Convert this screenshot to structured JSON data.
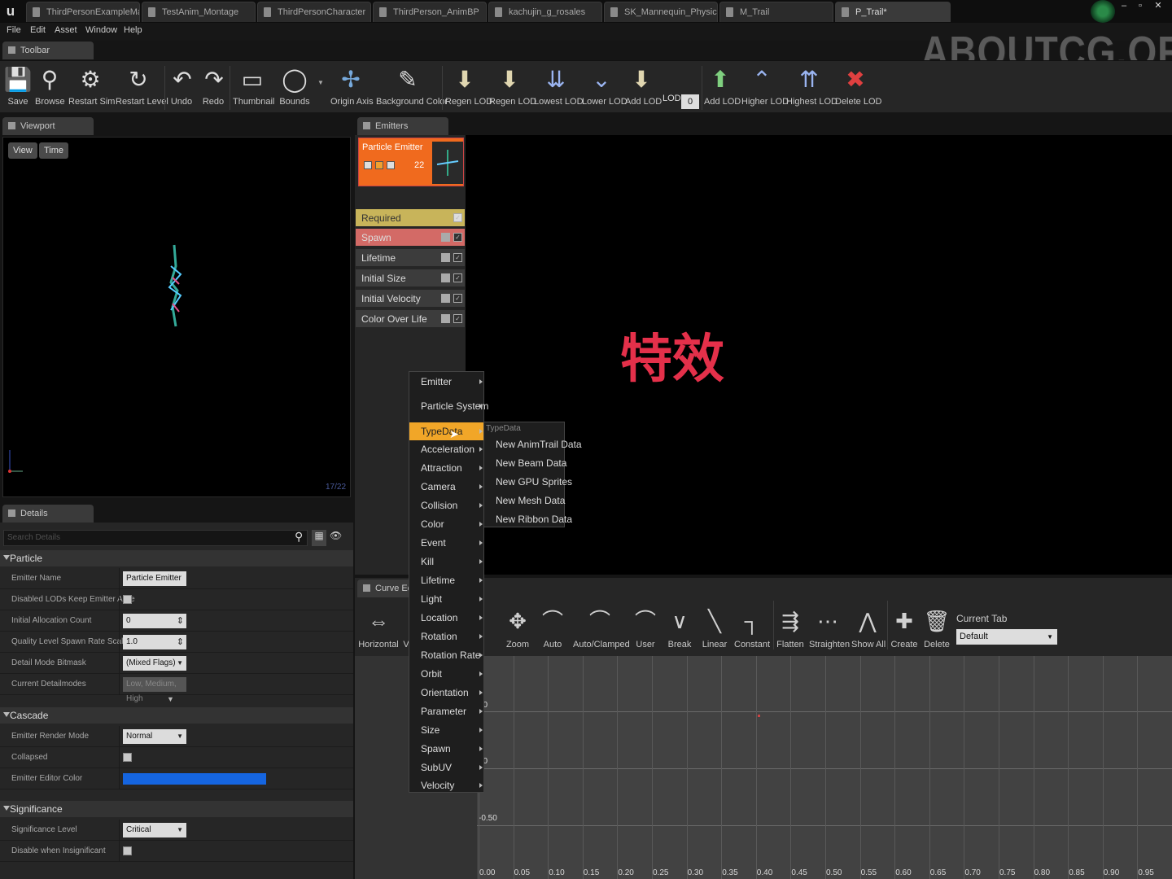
{
  "doc_tabs": [
    {
      "label": "ThirdPersonExampleMap"
    },
    {
      "label": "TestAnim_Montage"
    },
    {
      "label": "ThirdPersonCharacter"
    },
    {
      "label": "ThirdPerson_AnimBP"
    },
    {
      "label": "kachujin_g_rosales"
    },
    {
      "label": "SK_Mannequin_PhysicsAs"
    },
    {
      "label": "M_Trail"
    },
    {
      "label": "P_Trail*"
    }
  ],
  "logo": "u",
  "window_controls": [
    "–",
    "▫",
    "✕"
  ],
  "menu": [
    "File",
    "Edit",
    "Asset",
    "Window",
    "Help"
  ],
  "watermark": "ABOUTCG.ORG",
  "toolbar_tab": "Toolbar",
  "toolbar": [
    {
      "label": "Save",
      "icon": "save-icon"
    },
    {
      "label": "Browse",
      "icon": "browse-icon"
    },
    {
      "label": "Restart Sim",
      "icon": "restart-sim-icon"
    },
    {
      "label": "Restart Level",
      "icon": "restart-level-icon"
    },
    {
      "label": "Undo",
      "icon": "undo-icon"
    },
    {
      "label": "Redo",
      "icon": "redo-icon"
    },
    {
      "label": "Thumbnail",
      "icon": "thumbnail-icon"
    },
    {
      "label": "Bounds",
      "icon": "bounds-icon"
    },
    {
      "label": "Origin Axis",
      "icon": "origin-axis-icon"
    },
    {
      "label": "Background Color",
      "icon": "background-color-icon"
    },
    {
      "label": "Regen LOD",
      "icon": "regen-lod-icon"
    },
    {
      "label": "Regen LOD",
      "icon": "regen-lod-icon"
    },
    {
      "label": "Lowest LOD",
      "icon": "lowest-lod-icon"
    },
    {
      "label": "Lower LOD",
      "icon": "lower-lod-icon"
    },
    {
      "label": "Add LOD",
      "icon": "add-lod-icon"
    },
    {
      "label": "Add LOD",
      "icon": "add-lod-icon"
    },
    {
      "label": "Higher LOD",
      "icon": "higher-lod-icon"
    },
    {
      "label": "Highest LOD",
      "icon": "highest-lod-icon"
    },
    {
      "label": "Delete LOD",
      "icon": "delete-lod-icon"
    }
  ],
  "lod": {
    "label": "LOD",
    "value": "0"
  },
  "viewport": {
    "tab": "Viewport",
    "view_btn": "View",
    "time_btn": "Time",
    "counter": "17/22"
  },
  "details": {
    "tab": "Details",
    "search_placeholder": "Search Details",
    "categories": {
      "particle": "Particle",
      "cascade": "Cascade",
      "significance": "Significance"
    },
    "particle_props": [
      {
        "label": "Emitter Name",
        "value": "Particle Emitter"
      },
      {
        "label": "Disabled LODs Keep Emitter Alive",
        "value": ""
      },
      {
        "label": "Initial Allocation Count",
        "value": "0"
      },
      {
        "label": "Quality Level Spawn Rate Scale",
        "value": "1.0"
      },
      {
        "label": "Detail Mode Bitmask",
        "value": "(Mixed Flags)"
      },
      {
        "label": "Current Detailmodes",
        "value": "Low, Medium, High"
      }
    ],
    "cascade_props": [
      {
        "label": "Emitter Render Mode",
        "value": "Normal"
      },
      {
        "label": "Collapsed",
        "value": ""
      },
      {
        "label": "Emitter Editor Color",
        "value": "#1565e0"
      }
    ],
    "significance_props": [
      {
        "label": "Significance Level",
        "value": "Critical"
      },
      {
        "label": "Disable when Insignificant",
        "value": ""
      }
    ]
  },
  "emitters": {
    "tab": "Emitters",
    "emitter_name": "Particle Emitter",
    "emitter_count": "22",
    "modules": [
      "Required",
      "Spawn",
      "Lifetime",
      "Initial Size",
      "Initial Velocity",
      "Color Over Life"
    ]
  },
  "overlay_text": "特效",
  "context_menu": {
    "items": [
      "Emitter",
      "Particle System",
      "TypeData",
      "Acceleration",
      "Attraction",
      "Camera",
      "Collision",
      "Color",
      "Event",
      "Kill",
      "Lifetime",
      "Light",
      "Location",
      "Rotation",
      "Rotation Rate",
      "Orbit",
      "Orientation",
      "Parameter",
      "Size",
      "Spawn",
      "SubUV",
      "Velocity"
    ],
    "highlighted": "TypeData"
  },
  "submenu": {
    "header": "TypeData",
    "items": [
      "New AnimTrail Data",
      "New Beam Data",
      "New GPU Sprites",
      "New Mesh Data",
      "New Ribbon Data"
    ]
  },
  "curve_editor": {
    "tab": "Curve Editor",
    "buttons": [
      {
        "label": "Horizontal",
        "icon": "horizontal-fit-icon"
      },
      {
        "label": "V",
        "icon": "vertical-fit-icon"
      },
      {
        "label": "Zoom",
        "icon": "zoom-icon"
      },
      {
        "label": "Auto",
        "icon": "auto-tangent-icon"
      },
      {
        "label": "Auto/Clamped",
        "icon": "auto-clamped-icon"
      },
      {
        "label": "User",
        "icon": "user-tangent-icon"
      },
      {
        "label": "Break",
        "icon": "break-tangent-icon"
      },
      {
        "label": "Linear",
        "icon": "linear-icon"
      },
      {
        "label": "Constant",
        "icon": "constant-icon"
      },
      {
        "label": "Flatten",
        "icon": "flatten-icon"
      },
      {
        "label": "Straighten",
        "icon": "straighten-icon"
      },
      {
        "label": "Show All",
        "icon": "show-all-icon"
      },
      {
        "label": "Create",
        "icon": "create-icon"
      },
      {
        "label": "Delete",
        "icon": "delete-icon"
      }
    ],
    "current_tab_label": "Current Tab",
    "current_tab_value": "Default",
    "y_labels": [
      "50",
      "00",
      "-0.50"
    ],
    "x_labels": [
      "0.00",
      "0.05",
      "0.10",
      "0.15",
      "0.20",
      "0.25",
      "0.30",
      "0.35",
      "0.40",
      "0.45",
      "0.50",
      "0.55",
      "0.60",
      "0.65",
      "0.70",
      "0.75",
      "0.80",
      "0.85",
      "0.90",
      "0.95"
    ]
  }
}
